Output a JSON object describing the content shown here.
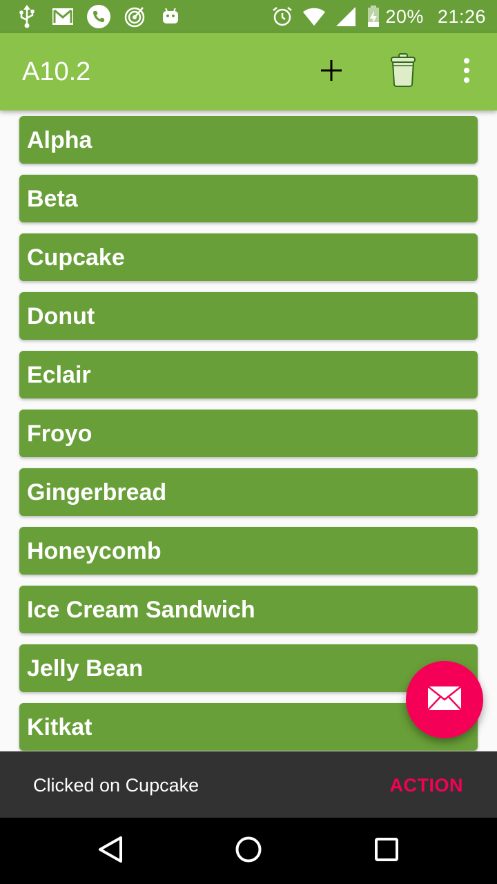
{
  "status_bar": {
    "battery_percent": "20%",
    "time": "21:26",
    "icons_left": [
      "usb-icon",
      "gmail-icon",
      "phone-icon",
      "radar-icon",
      "android-icon"
    ],
    "icons_right": [
      "alarm-icon",
      "wifi-icon",
      "signal-icon",
      "battery-charging-icon"
    ]
  },
  "app_bar": {
    "title": "A10.2",
    "actions": [
      "add-icon",
      "trash-icon",
      "overflow-menu-icon"
    ]
  },
  "list": {
    "items": [
      {
        "label": "Alpha"
      },
      {
        "label": "Beta"
      },
      {
        "label": "Cupcake"
      },
      {
        "label": "Donut"
      },
      {
        "label": "Eclair"
      },
      {
        "label": "Froyo"
      },
      {
        "label": "Gingerbread"
      },
      {
        "label": "Honeycomb"
      },
      {
        "label": "Ice Cream Sandwich"
      },
      {
        "label": "Jelly Bean"
      },
      {
        "label": "Kitkat"
      }
    ]
  },
  "fab": {
    "icon": "mail-icon"
  },
  "snackbar": {
    "message": "Clicked on Cupcake",
    "action_label": "ACTION"
  },
  "nav_bar": {
    "buttons": [
      "back-icon",
      "home-icon",
      "recents-icon"
    ]
  },
  "colors": {
    "primary": "#8bc34a",
    "primary_dark": "#689f38",
    "accent": "#f50057",
    "snackbar_bg": "#323232"
  }
}
